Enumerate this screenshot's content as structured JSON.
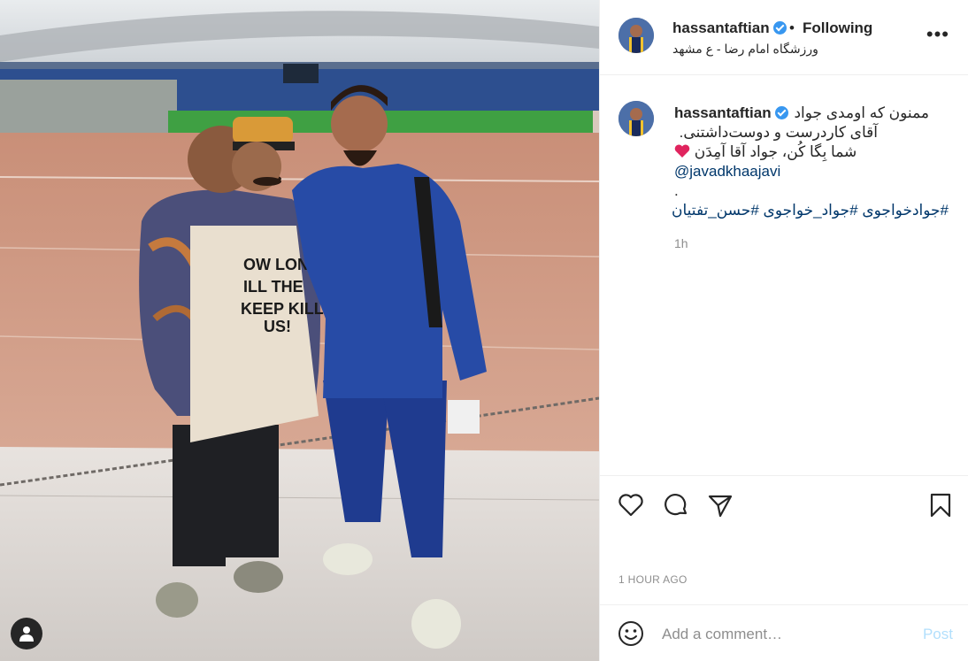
{
  "post": {
    "username": "hassantaftian",
    "follow_status": "Following",
    "separator": "•",
    "location": "ورزشگاه امام رضا - ع مشهد",
    "more_label": "•••"
  },
  "caption": {
    "username": "hassantaftian",
    "line1": "ممنون که اومدی جواد",
    "line2": "آقای کاردرست و دوست‌داشتنی.",
    "line3": "شما بِگا کُن، جواد آقا آمِدَن",
    "mention": "@javadkhaajavi",
    "dot": ".",
    "hashtags": "#جوادخواجوی #جواد_خواجوی #حسن_تفتیان",
    "relative_time": "1h"
  },
  "actions": {
    "like_icon": "heart-icon",
    "comment_icon": "comment-icon",
    "share_icon": "paper-plane-icon",
    "save_icon": "bookmark-icon",
    "timestamp": "1 HOUR AGO"
  },
  "comment_box": {
    "placeholder": "Add a comment…",
    "post_label": "Post"
  },
  "colors": {
    "link": "#00376b",
    "verified": "#3897f0",
    "post_disabled": "#b2dffc",
    "muted": "#8e8e8e"
  }
}
